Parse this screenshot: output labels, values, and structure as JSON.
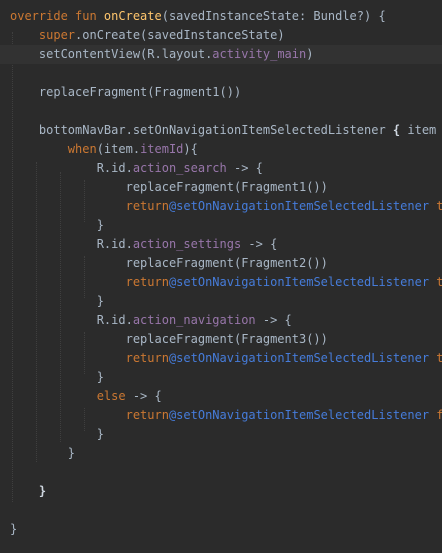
{
  "code_lines": [
    {
      "tokens": [
        {
          "t": "override fun ",
          "c": "kw"
        },
        {
          "t": "onCreate",
          "c": "fn"
        },
        {
          "t": "(savedInstanceState: Bundle?) {",
          "c": "plain"
        }
      ]
    },
    {
      "tokens": [
        {
          "t": "    ",
          "c": "plain"
        },
        {
          "t": "super",
          "c": "kw"
        },
        {
          "t": ".onCreate(savedInstanceState)",
          "c": "plain"
        }
      ]
    },
    {
      "tokens": [
        {
          "t": "    setContentView(R.layout.",
          "c": "plain"
        },
        {
          "t": "activity_main",
          "c": "prop"
        },
        {
          "t": ")",
          "c": "plain"
        }
      ]
    },
    {
      "tokens": []
    },
    {
      "tokens": [
        {
          "t": "    replaceFragment(Fragment1())",
          "c": "plain"
        }
      ]
    },
    {
      "tokens": []
    },
    {
      "tokens": [
        {
          "t": "    bottomNavBar.setOnNavigationItemSelectedListener ",
          "c": "plain"
        },
        {
          "t": "{",
          "c": "bold"
        },
        {
          "t": " item ->",
          "c": "plain"
        }
      ]
    },
    {
      "tokens": [
        {
          "t": "        ",
          "c": "plain"
        },
        {
          "t": "when",
          "c": "kw"
        },
        {
          "t": "(item.",
          "c": "plain"
        },
        {
          "t": "itemId",
          "c": "prop"
        },
        {
          "t": "){",
          "c": "plain"
        }
      ]
    },
    {
      "tokens": [
        {
          "t": "            R.id.",
          "c": "plain"
        },
        {
          "t": "action_search",
          "c": "prop"
        },
        {
          "t": " -> {",
          "c": "plain"
        }
      ]
    },
    {
      "tokens": [
        {
          "t": "                replaceFragment(Fragment1())",
          "c": "plain"
        }
      ]
    },
    {
      "tokens": [
        {
          "t": "                ",
          "c": "plain"
        },
        {
          "t": "return",
          "c": "kw"
        },
        {
          "t": "@setOnNavigationItemSelectedListener",
          "c": "lbl"
        },
        {
          "t": " true",
          "c": "kw"
        }
      ]
    },
    {
      "tokens": [
        {
          "t": "            }",
          "c": "plain"
        }
      ]
    },
    {
      "tokens": [
        {
          "t": "            R.id.",
          "c": "plain"
        },
        {
          "t": "action_settings",
          "c": "prop"
        },
        {
          "t": " -> {",
          "c": "plain"
        }
      ]
    },
    {
      "tokens": [
        {
          "t": "                replaceFragment(Fragment2())",
          "c": "plain"
        }
      ]
    },
    {
      "tokens": [
        {
          "t": "                ",
          "c": "plain"
        },
        {
          "t": "return",
          "c": "kw"
        },
        {
          "t": "@setOnNavigationItemSelectedListener",
          "c": "lbl"
        },
        {
          "t": " true",
          "c": "kw"
        }
      ]
    },
    {
      "tokens": [
        {
          "t": "            }",
          "c": "plain"
        }
      ]
    },
    {
      "tokens": [
        {
          "t": "            R.id.",
          "c": "plain"
        },
        {
          "t": "action_navigation",
          "c": "prop"
        },
        {
          "t": " -> {",
          "c": "plain"
        }
      ]
    },
    {
      "tokens": [
        {
          "t": "                replaceFragment(Fragment3())",
          "c": "plain"
        }
      ]
    },
    {
      "tokens": [
        {
          "t": "                ",
          "c": "plain"
        },
        {
          "t": "return",
          "c": "kw"
        },
        {
          "t": "@setOnNavigationItemSelectedListener",
          "c": "lbl"
        },
        {
          "t": " true",
          "c": "kw"
        }
      ]
    },
    {
      "tokens": [
        {
          "t": "            }",
          "c": "plain"
        }
      ]
    },
    {
      "tokens": [
        {
          "t": "            ",
          "c": "plain"
        },
        {
          "t": "else",
          "c": "kw"
        },
        {
          "t": " -> {",
          "c": "plain"
        }
      ]
    },
    {
      "tokens": [
        {
          "t": "                ",
          "c": "plain"
        },
        {
          "t": "return",
          "c": "kw"
        },
        {
          "t": "@setOnNavigationItemSelectedListener",
          "c": "lbl"
        },
        {
          "t": " false",
          "c": "kw"
        }
      ]
    },
    {
      "tokens": [
        {
          "t": "            }",
          "c": "plain"
        }
      ]
    },
    {
      "tokens": [
        {
          "t": "        }",
          "c": "plain"
        }
      ]
    },
    {
      "tokens": []
    },
    {
      "tokens": [
        {
          "t": "    ",
          "c": "plain"
        },
        {
          "t": "}",
          "c": "bold"
        }
      ]
    },
    {
      "tokens": []
    },
    {
      "tokens": [
        {
          "t": "}",
          "c": "plain"
        }
      ]
    }
  ],
  "colors": {
    "background": "#2b2b2b",
    "keyword": "#cc7832",
    "function": "#ffc66d",
    "property": "#9876aa",
    "label": "#467cda",
    "text": "#a9b7c6"
  }
}
